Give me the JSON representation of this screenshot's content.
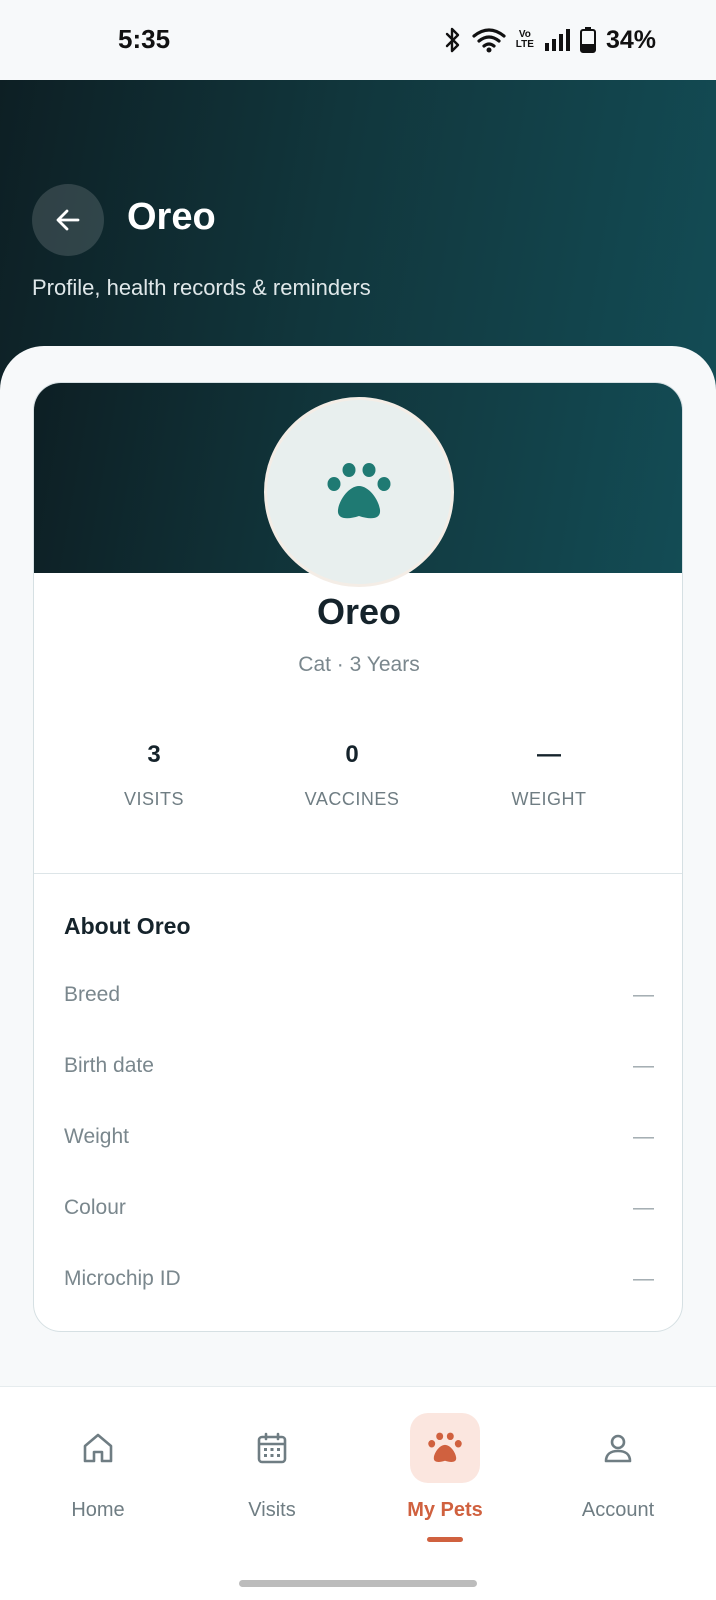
{
  "status_bar": {
    "time": "5:35",
    "battery": "34%",
    "volte_top": "Vo",
    "volte_bottom": "LTE"
  },
  "header": {
    "title": "Oreo",
    "subtitle": "Profile, health records & reminders"
  },
  "profile": {
    "name": "Oreo",
    "meta": "Cat · 3 Years",
    "avatar_icon": "paw-icon",
    "stats": [
      {
        "value": "3",
        "label": "VISITS"
      },
      {
        "value": "0",
        "label": "VACCINES"
      },
      {
        "value": "—",
        "label": "WEIGHT"
      }
    ]
  },
  "about": {
    "title": "About Oreo",
    "rows": [
      {
        "label": "Breed",
        "value": "—"
      },
      {
        "label": "Birth date",
        "value": "—"
      },
      {
        "label": "Weight",
        "value": "—"
      },
      {
        "label": "Colour",
        "value": "—"
      },
      {
        "label": "Microchip ID",
        "value": "—"
      }
    ]
  },
  "nav": {
    "items": [
      {
        "label": "Home",
        "icon": "home-icon"
      },
      {
        "label": "Visits",
        "icon": "calendar-icon"
      },
      {
        "label": "My Pets",
        "icon": "paw-icon"
      },
      {
        "label": "Account",
        "icon": "user-icon"
      }
    ],
    "active": "My Pets"
  },
  "colors": {
    "header_dark": "#0d1f24",
    "header_teal": "#134c55",
    "accent": "#d0613f",
    "paw_teal": "#1f7a73"
  }
}
